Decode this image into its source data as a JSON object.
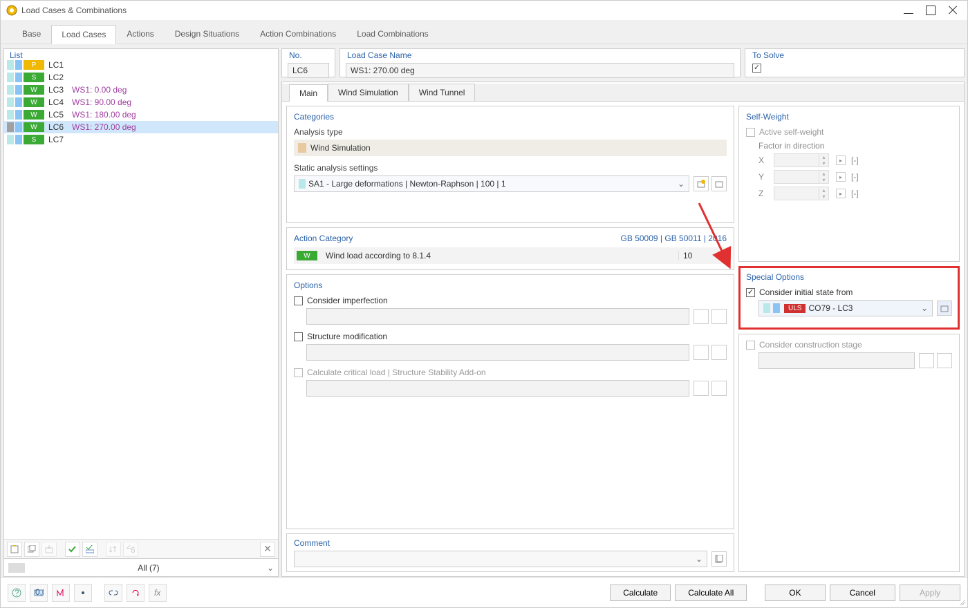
{
  "window": {
    "title": "Load Cases & Combinations"
  },
  "top_tabs": [
    "Base",
    "Load Cases",
    "Actions",
    "Design Situations",
    "Action Combinations",
    "Load Combinations"
  ],
  "top_tab_active": 1,
  "list": {
    "title": "List",
    "items": [
      {
        "chips": [
          "cy",
          "bl"
        ],
        "badge": "P",
        "code": "LC1",
        "name": "",
        "nameClass": "plain"
      },
      {
        "chips": [
          "cy",
          "bl"
        ],
        "badge": "S",
        "code": "LC2",
        "name": "",
        "nameClass": "plain"
      },
      {
        "chips": [
          "cy",
          "bl"
        ],
        "badge": "W",
        "code": "LC3",
        "name": "WS1: 0.00 deg"
      },
      {
        "chips": [
          "cy",
          "bl"
        ],
        "badge": "W",
        "code": "LC4",
        "name": "WS1: 90.00 deg"
      },
      {
        "chips": [
          "cy",
          "bl"
        ],
        "badge": "W",
        "code": "LC5",
        "name": "WS1: 180.00 deg"
      },
      {
        "chips": [
          "gr",
          "bl"
        ],
        "badge": "W",
        "code": "LC6",
        "name": "WS1: 270.00 deg",
        "selected": true
      },
      {
        "chips": [
          "cy",
          "bl"
        ],
        "badge": "S",
        "code": "LC7",
        "name": "",
        "nameClass": "plain"
      }
    ],
    "filter": "All (7)"
  },
  "header": {
    "no_label": "No.",
    "no_value": "LC6",
    "name_label": "Load Case Name",
    "name_value": "WS1: 270.00 deg",
    "solve_label": "To Solve"
  },
  "mid_tabs": [
    "Main",
    "Wind Simulation",
    "Wind Tunnel"
  ],
  "categories": {
    "title": "Categories",
    "analysis_type_label": "Analysis type",
    "analysis_type_value": "Wind Simulation",
    "sas_label": "Static analysis settings",
    "sas_value": "SA1 - Large deformations | Newton-Raphson | 100 | 1"
  },
  "action_category": {
    "title": "Action Category",
    "codes": "GB 50009 | GB 50011 | 2016",
    "row_label": "Wind load according to 8.1.4",
    "row_num": "10"
  },
  "options": {
    "title": "Options",
    "imperfection": "Consider imperfection",
    "structure_mod": "Structure modification",
    "critical": "Calculate critical load | Structure Stability Add-on"
  },
  "self_weight": {
    "title": "Self-Weight",
    "active": "Active self-weight",
    "factor_label": "Factor in direction",
    "x": "X",
    "y": "Y",
    "z": "Z",
    "unit": "[-]"
  },
  "special": {
    "title": "Special Options",
    "initial": "Consider initial state from",
    "combo": "CO79 - LC3",
    "uls": "ULS",
    "construction": "Consider construction stage"
  },
  "comment": {
    "title": "Comment"
  },
  "footer": {
    "calculate": "Calculate",
    "calculate_all": "Calculate All",
    "ok": "OK",
    "cancel": "Cancel",
    "apply": "Apply"
  }
}
